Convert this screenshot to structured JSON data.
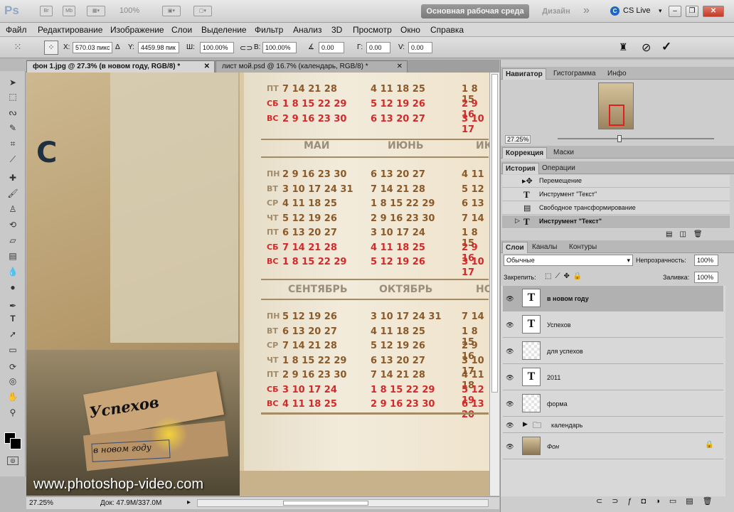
{
  "titlebar": {
    "app_logo": "Ps",
    "zoom": "100%",
    "workspace": "Основная рабочая среда",
    "design": "Дизайн",
    "more": "»",
    "cs_live": "CS Live"
  },
  "menu": [
    "Файл",
    "Редактирование",
    "Изображение",
    "Слои",
    "Выделение",
    "Фильтр",
    "Анализ",
    "3D",
    "Просмотр",
    "Окно",
    "Справка"
  ],
  "options": {
    "x_label": "X:",
    "x_value": "570.03 пикс",
    "y_label": "Y:",
    "y_value": "4459.98 пик",
    "w_label": "Ш:",
    "w_value": "100.00%",
    "h_label": "В:",
    "h_value": "100.00%",
    "angle_value": "0.00",
    "h_skew_label": "Г:",
    "h_skew_value": "0.00",
    "v_skew_label": "V:",
    "v_skew_value": "0.00"
  },
  "tabs": [
    {
      "label": "фон 1.jpg @ 27.3% (в новом году, RGB/8) *"
    },
    {
      "label": "лист мой.psd @ 16.7% (календарь, RGB/8) *"
    }
  ],
  "canvas": {
    "calendar_rows_top": [
      [
        "ПТ",
        "7 14 21 28",
        "4 11 18 25",
        "1 8 15"
      ],
      [
        "СБ",
        "1 8 15 22 29",
        "5 12 19 26",
        "2 9 16"
      ],
      [
        "ВС",
        "2 9 16 23 30",
        "6 13 20 27",
        "3 10 17"
      ]
    ],
    "month_row1": [
      "МАЙ",
      "ИЮНЬ",
      "ИЮ"
    ],
    "month_row2": [
      "СЕНТЯБРЬ",
      "ОКТЯБРЬ",
      "НО"
    ],
    "block2": [
      [
        "ПН",
        "2 9 16 23 30",
        "6 13 20 27",
        "4 11"
      ],
      [
        "ВТ",
        "3 10 17 24 31",
        "7 14 21 28",
        "5 12"
      ],
      [
        "СР",
        "4 11 18 25",
        "1 8 15 22 29",
        "6 13"
      ],
      [
        "ЧТ",
        "5 12 19 26",
        "2 9 16 23 30",
        "7 14"
      ],
      [
        "ПТ",
        "6 13 20 27",
        "3 10 17 24",
        "1 8 15"
      ],
      [
        "СБ",
        "7 14 21 28",
        "4 11 18 25",
        "2 9 16"
      ],
      [
        "ВС",
        "1 8 15 22 29",
        "5 12 19 26",
        "3 10 17"
      ]
    ],
    "block3": [
      [
        "ПН",
        "5 12 19 26",
        "3 10 17 24 31",
        "7 14"
      ],
      [
        "ВТ",
        "6 13 20 27",
        "4 11 18 25",
        "1 8 15"
      ],
      [
        "СР",
        "7 14 21 28",
        "5 12 19 26",
        "2 9 16"
      ],
      [
        "ЧТ",
        "1 8 15 22 29",
        "6 13 20 27",
        "3 10 17"
      ],
      [
        "ПТ",
        "2 9 16 23 30",
        "7 14 21 28",
        "4 11 18"
      ],
      [
        "СБ",
        "3 10 17 24",
        "1 8 15 22 29",
        "5 12 19"
      ],
      [
        "ВС",
        "4 11 18 25",
        "2 9 16 23 30",
        "6 13 20"
      ]
    ],
    "label_big": "Успехов",
    "label_small": "в новом году",
    "watermark": "www.photoshop-video.com"
  },
  "status": {
    "zoom": "27.25%",
    "doc": "Док: 47.9M/337.0M"
  },
  "navigator": {
    "tabs": [
      "Навигатор",
      "Гистограмма",
      "Инфо"
    ],
    "zoom": "27.25%"
  },
  "adjust": {
    "tabs": [
      "Коррекция",
      "Маски"
    ]
  },
  "history": {
    "tabs": [
      "История",
      "Операции"
    ],
    "items": [
      "Перемещение",
      "Инструмент \"Текст\"",
      "Свободное трансформирование",
      "Инструмент \"Текст\""
    ]
  },
  "layers": {
    "tabs": [
      "Слои",
      "Каналы",
      "Контуры"
    ],
    "blend": "Обычные",
    "opacity_label": "Непрозрачность:",
    "opacity": "100%",
    "lock_label": "Закрепить:",
    "fill_label": "Заливка:",
    "fill": "100%",
    "items": [
      {
        "name": "в новом году",
        "kind": "text",
        "selected": true
      },
      {
        "name": "Успехов",
        "kind": "text"
      },
      {
        "name": "для успехов",
        "kind": "raster"
      },
      {
        "name": "2011",
        "kind": "text"
      },
      {
        "name": "форма",
        "kind": "raster"
      },
      {
        "name": "календарь",
        "kind": "group"
      },
      {
        "name": "Фон",
        "kind": "bg"
      }
    ]
  }
}
